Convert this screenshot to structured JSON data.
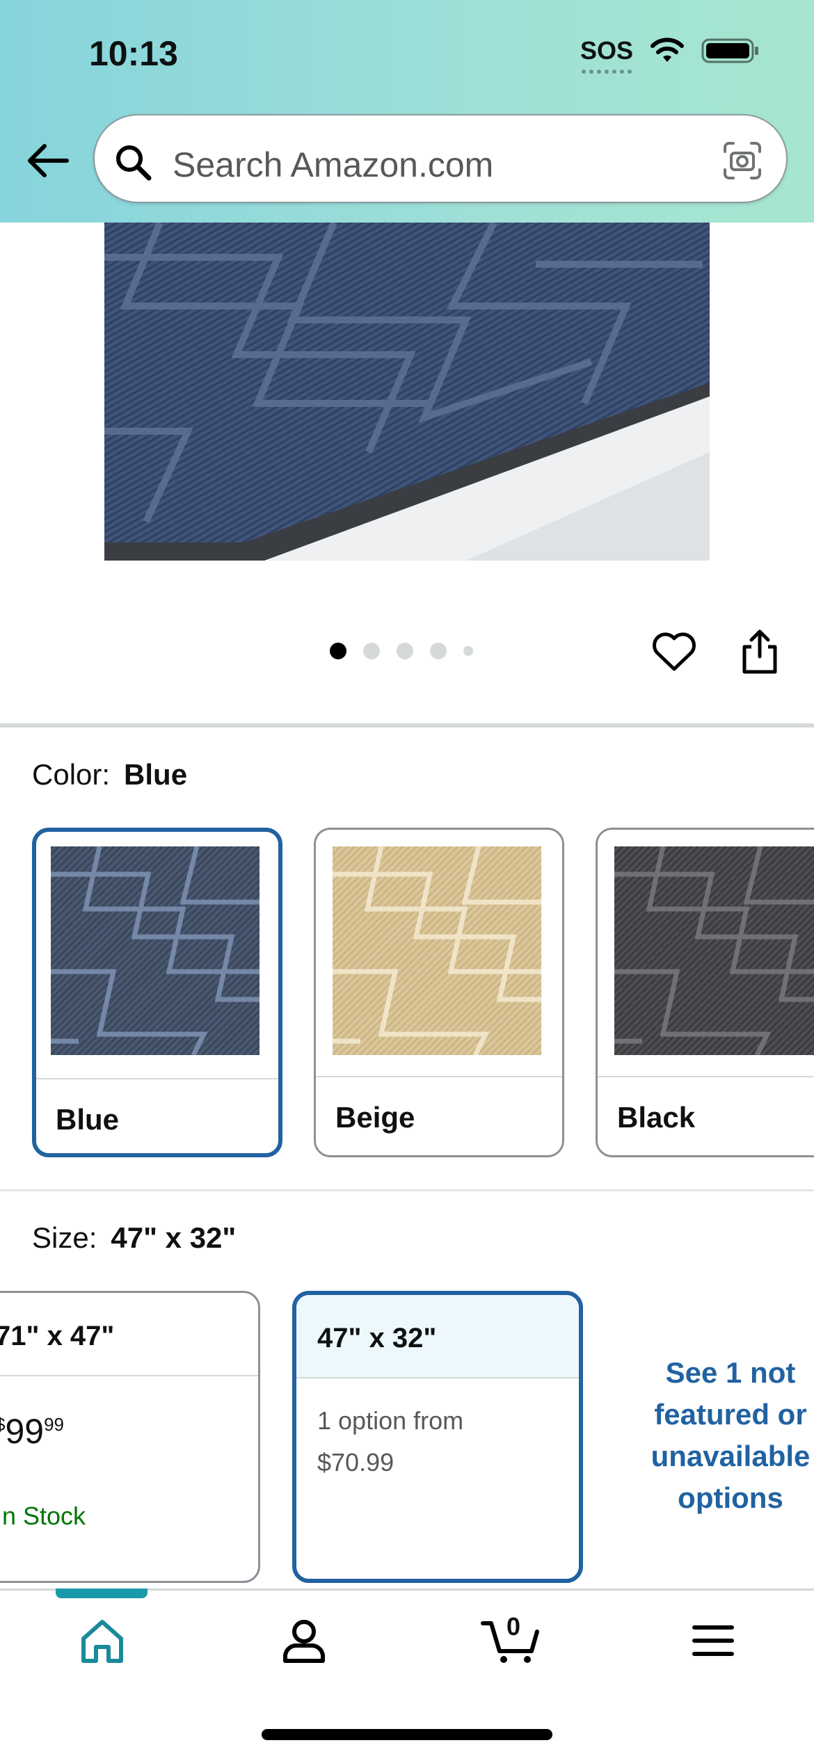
{
  "status_bar": {
    "time": "10:13",
    "sos": "SOS"
  },
  "search": {
    "placeholder": "Search Amazon.com"
  },
  "carousel": {
    "total_images": 5,
    "active_index": 0
  },
  "color": {
    "label": "Color:",
    "selected": "Blue",
    "options": [
      {
        "name": "Blue",
        "selected": true
      },
      {
        "name": "Beige",
        "selected": false
      },
      {
        "name": "Black",
        "selected": false
      }
    ]
  },
  "size": {
    "label": "Size:",
    "selected": "47\" x 32\"",
    "options": [
      {
        "name": "71\" x 47\"",
        "price_symbol": "$",
        "price_whole": "99",
        "price_fraction": "99",
        "stock": "In Stock",
        "selected": false
      },
      {
        "name": "47\" x 32\"",
        "option_line1": "1 option from",
        "option_line2": "$70.99",
        "selected": true
      }
    ],
    "see_more": "See 1 not featured or unavailable options"
  },
  "bottom_nav": {
    "cart_count": "0",
    "active_tab": "home"
  },
  "colors": {
    "accent_blue": "#2162a1",
    "teal": "#1a99a8",
    "in_stock_green": "#007600"
  }
}
